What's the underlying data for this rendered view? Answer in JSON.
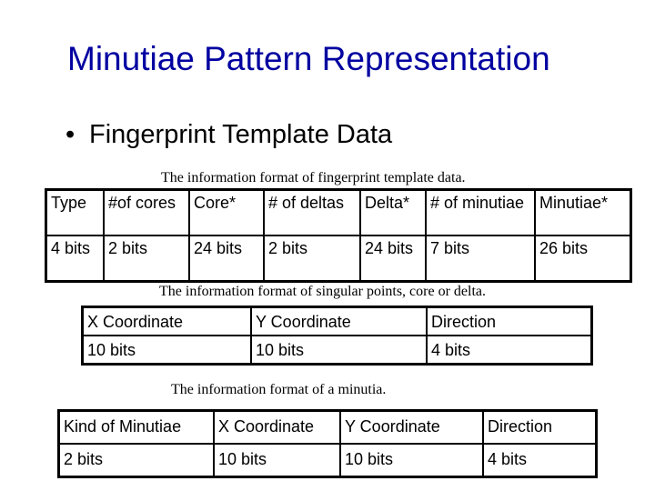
{
  "slide": {
    "title": "Minutiae Pattern Representation",
    "bullet": "Fingerprint Template Data"
  },
  "template_table": {
    "caption": "The information format of fingerprint template data.",
    "headers": [
      "Type",
      "#of cores",
      "Core*",
      "# of deltas",
      "Delta*",
      "# of minutiae",
      "Minutiae*"
    ],
    "values": [
      "4 bits",
      "2 bits",
      "24 bits",
      "2 bits",
      "24 bits",
      "7 bits",
      "26 bits"
    ]
  },
  "singular_table": {
    "caption": "The information format of singular points, core or delta.",
    "headers": [
      "X Coordinate",
      "Y Coordinate",
      "Direction"
    ],
    "values": [
      "10 bits",
      "10 bits",
      "4 bits"
    ]
  },
  "minutia_table": {
    "caption": "The information format of a minutia.",
    "headers": [
      "Kind of Minutiae",
      "X Coordinate",
      "Y Coordinate",
      "Direction"
    ],
    "values": [
      "2 bits",
      "10 bits",
      "10 bits",
      "4 bits"
    ]
  }
}
